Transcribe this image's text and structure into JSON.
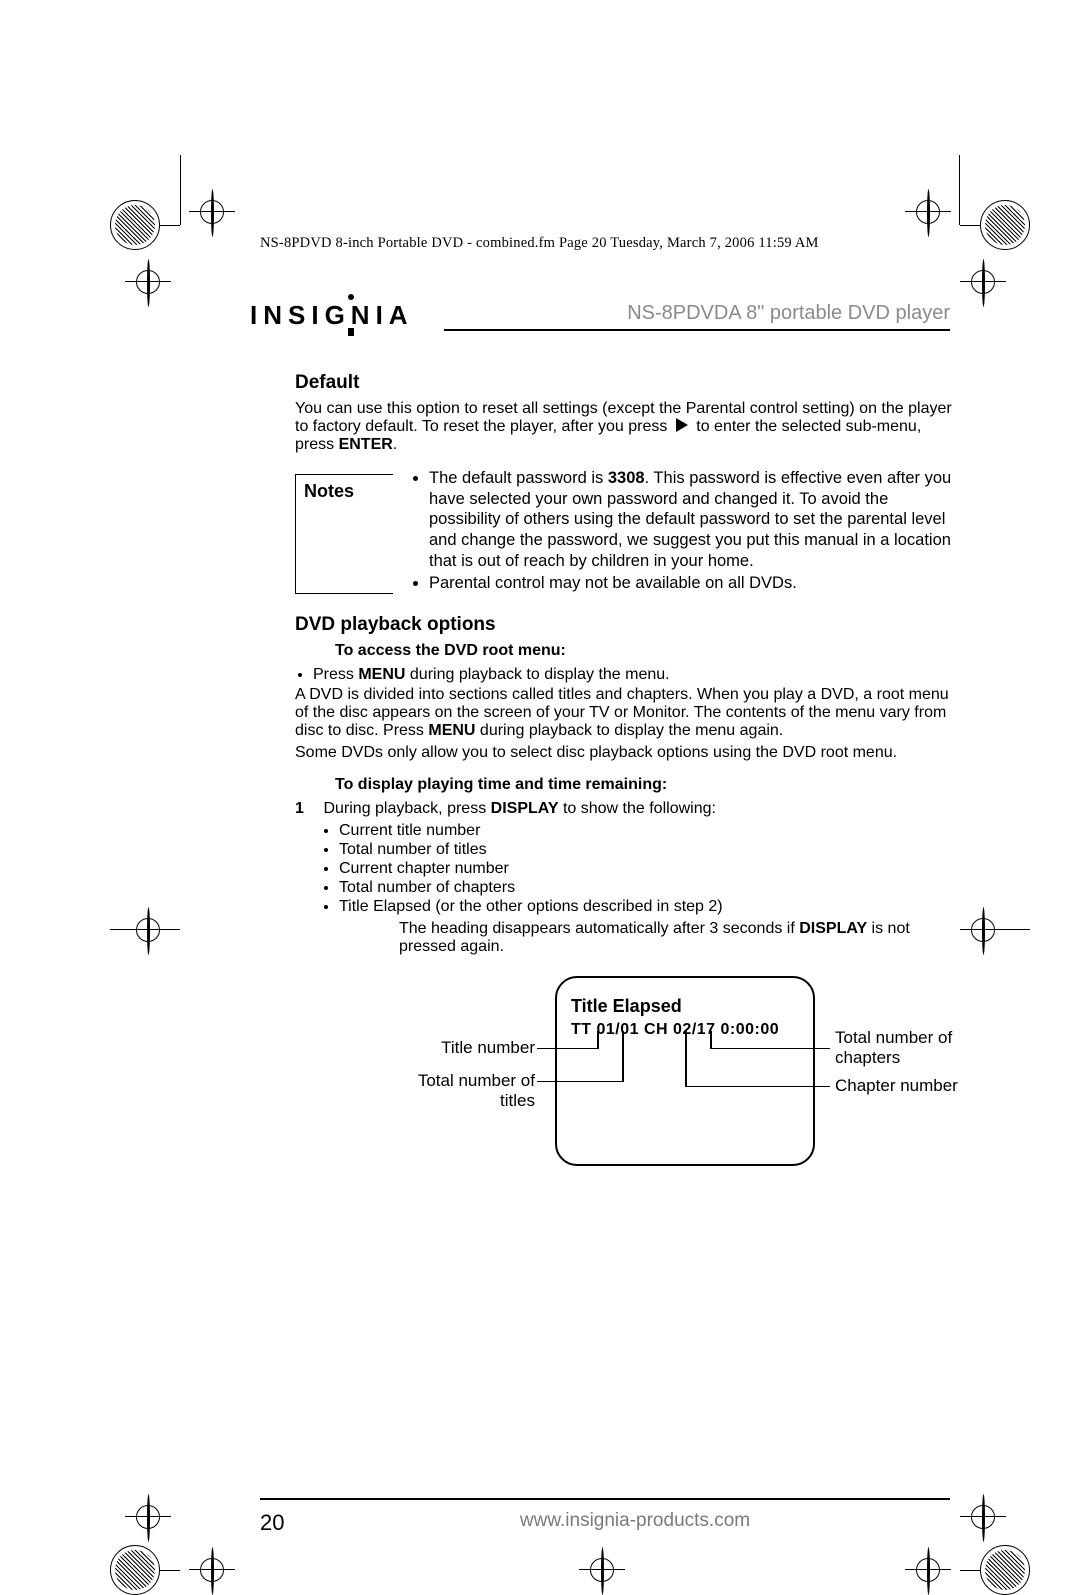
{
  "meta_header": "NS-8PDVD 8-inch Portable DVD - combined.fm  Page 20  Tuesday, March 7, 2006  11:59 AM",
  "brand": "INSIGNIA",
  "product": "NS-8PDVDA 8\" portable DVD player",
  "sections": {
    "default": {
      "heading": "Default",
      "body_pre": "You can use this option to reset all settings (except the Parental control setting) on the player to factory default. To reset the player, after you press ",
      "body_post": " to enter the selected sub-menu, press ",
      "enter": "ENTER",
      "period": "."
    },
    "notes": {
      "label": "Notes",
      "bullets": [
        {
          "pre": "The default password is ",
          "bold": "3308",
          "post": ". This password is effective even after you have selected your own password and changed it. To avoid the possibility of others using the default password to set the parental level and change the password, we suggest you put this manual in a location that is out of reach by children in your home."
        },
        {
          "pre": "Parental control may not be available on all DVDs.",
          "bold": "",
          "post": ""
        }
      ]
    },
    "playback": {
      "heading": "DVD playback options",
      "root_menu": {
        "heading": "To access the DVD root menu:",
        "bullet_pre": "Press ",
        "bullet_bold": "MENU",
        "bullet_post": " during playback to display the menu.",
        "para1_pre": "A DVD is divided into sections called titles and chapters. When you play a DVD, a root menu of the disc appears on the screen of your TV or Monitor. The contents of the menu vary from disc to disc. Press ",
        "para1_bold": "MENU",
        "para1_post": " during playback to display the menu again.",
        "para2": "Some DVDs only allow you to select disc playback options using the DVD root menu."
      },
      "display": {
        "heading": "To display playing time and time remaining:",
        "step_num": "1",
        "step_pre": "During playback, press ",
        "step_bold": "DISPLAY",
        "step_post": " to show the following:",
        "items": [
          "Current title number",
          "Total number of titles",
          "Current chapter number",
          "Total number of chapters",
          "Title Elapsed (or the other options described in step 2)"
        ],
        "after_pre": "The heading disappears automatically after 3 seconds if ",
        "after_bold": "DISPLAY",
        "after_post": " is not pressed again."
      }
    },
    "diagram": {
      "osd_title": "Title Elapsed",
      "osd_line": "TT 01/01  CH 02/17  0:00:00",
      "labels": {
        "title_number": "Title number",
        "total_titles": "Total number of titles",
        "total_chapters": "Total number of chapters",
        "chapter_number": "Chapter number"
      }
    }
  },
  "footer": {
    "page": "20",
    "url": "www.insignia-products.com"
  }
}
